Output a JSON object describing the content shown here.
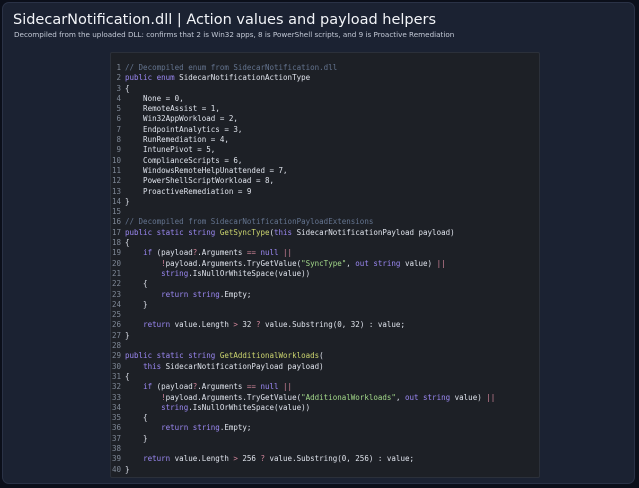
{
  "header": {
    "title": "SidecarNotification.dll  |  Action values and payload helpers",
    "subtitle": "Decompiled from the uploaded DLL: confirms that 2 is Win32 apps, 8 is PowerShell scripts, and 9 is Proactive Remediation"
  },
  "theme": {
    "background": "#0b0f1a",
    "card": "#1b2232",
    "code_background": "#1d2026",
    "comment": "#64748f",
    "keyword": "#9b88f3",
    "method": "#cdd66f",
    "string": "#a3d98a",
    "operator": "#d3869b",
    "plain": "#dfe3ec",
    "line_number": "#7f8896"
  },
  "code": {
    "language": "csharp",
    "lines": [
      {
        "n": "1",
        "tokens": [
          {
            "t": "// Decompiled enum from SidecarNotification.dll",
            "k": "comment"
          }
        ]
      },
      {
        "n": "2",
        "tokens": [
          {
            "t": "public",
            "k": "keyword"
          },
          {
            "t": " ",
            "k": "plain"
          },
          {
            "t": "enum",
            "k": "keyword"
          },
          {
            "t": " SidecarNotificationActionType",
            "k": "type"
          }
        ]
      },
      {
        "n": "3",
        "tokens": [
          {
            "t": "{",
            "k": "punct"
          }
        ]
      },
      {
        "n": "4",
        "tokens": [
          {
            "t": "    None = ",
            "k": "plain"
          },
          {
            "t": "0",
            "k": "number"
          },
          {
            "t": ",",
            "k": "punct"
          }
        ]
      },
      {
        "n": "5",
        "tokens": [
          {
            "t": "    RemoteAssist = ",
            "k": "plain"
          },
          {
            "t": "1",
            "k": "number"
          },
          {
            "t": ",",
            "k": "punct"
          }
        ]
      },
      {
        "n": "6",
        "tokens": [
          {
            "t": "    Win32AppWorkload = ",
            "k": "plain"
          },
          {
            "t": "2",
            "k": "number"
          },
          {
            "t": ",",
            "k": "punct"
          }
        ]
      },
      {
        "n": "7",
        "tokens": [
          {
            "t": "    EndpointAnalytics = ",
            "k": "plain"
          },
          {
            "t": "3",
            "k": "number"
          },
          {
            "t": ",",
            "k": "punct"
          }
        ]
      },
      {
        "n": "8",
        "tokens": [
          {
            "t": "    RunRemediation = ",
            "k": "plain"
          },
          {
            "t": "4",
            "k": "number"
          },
          {
            "t": ",",
            "k": "punct"
          }
        ]
      },
      {
        "n": "9",
        "tokens": [
          {
            "t": "    IntunePivot = ",
            "k": "plain"
          },
          {
            "t": "5",
            "k": "number"
          },
          {
            "t": ",",
            "k": "punct"
          }
        ]
      },
      {
        "n": "10",
        "tokens": [
          {
            "t": "    ComplianceScripts = ",
            "k": "plain"
          },
          {
            "t": "6",
            "k": "number"
          },
          {
            "t": ",",
            "k": "punct"
          }
        ]
      },
      {
        "n": "11",
        "tokens": [
          {
            "t": "    WindowsRemoteHelpUnattended = ",
            "k": "plain"
          },
          {
            "t": "7",
            "k": "number"
          },
          {
            "t": ",",
            "k": "punct"
          }
        ]
      },
      {
        "n": "12",
        "tokens": [
          {
            "t": "    PowerShellScriptWorkload = ",
            "k": "plain"
          },
          {
            "t": "8",
            "k": "number"
          },
          {
            "t": ",",
            "k": "punct"
          }
        ]
      },
      {
        "n": "13",
        "tokens": [
          {
            "t": "    ProactiveRemediation = ",
            "k": "plain"
          },
          {
            "t": "9",
            "k": "number"
          }
        ]
      },
      {
        "n": "14",
        "tokens": [
          {
            "t": "}",
            "k": "punct"
          }
        ]
      },
      {
        "n": "15",
        "tokens": []
      },
      {
        "n": "16",
        "tokens": [
          {
            "t": "// Decompiled from SidecarNotificationPayloadExtensions",
            "k": "comment"
          }
        ]
      },
      {
        "n": "17",
        "tokens": [
          {
            "t": "public",
            "k": "keyword"
          },
          {
            "t": " ",
            "k": "plain"
          },
          {
            "t": "static",
            "k": "keyword"
          },
          {
            "t": " ",
            "k": "plain"
          },
          {
            "t": "string",
            "k": "keyword"
          },
          {
            "t": " ",
            "k": "plain"
          },
          {
            "t": "GetSyncType",
            "k": "method"
          },
          {
            "t": "(",
            "k": "punct"
          },
          {
            "t": "this",
            "k": "keyword"
          },
          {
            "t": " SidecarNotificationPayload payload)",
            "k": "plain"
          }
        ]
      },
      {
        "n": "18",
        "tokens": [
          {
            "t": "{",
            "k": "punct"
          }
        ]
      },
      {
        "n": "19",
        "tokens": [
          {
            "t": "    ",
            "k": "plain"
          },
          {
            "t": "if",
            "k": "keyword"
          },
          {
            "t": " (payload",
            "k": "plain"
          },
          {
            "t": "?",
            "k": "op"
          },
          {
            "t": ".Arguments ",
            "k": "plain"
          },
          {
            "t": "==",
            "k": "op"
          },
          {
            "t": " ",
            "k": "plain"
          },
          {
            "t": "null",
            "k": "keyword"
          },
          {
            "t": " ",
            "k": "plain"
          },
          {
            "t": "||",
            "k": "op"
          }
        ]
      },
      {
        "n": "20",
        "tokens": [
          {
            "t": "        ",
            "k": "plain"
          },
          {
            "t": "!",
            "k": "op"
          },
          {
            "t": "payload.Arguments.TryGetValue(",
            "k": "plain"
          },
          {
            "t": "\"SyncType\"",
            "k": "string"
          },
          {
            "t": ", ",
            "k": "plain"
          },
          {
            "t": "out",
            "k": "keyword"
          },
          {
            "t": " ",
            "k": "plain"
          },
          {
            "t": "string",
            "k": "keyword"
          },
          {
            "t": " value) ",
            "k": "plain"
          },
          {
            "t": "||",
            "k": "op"
          }
        ]
      },
      {
        "n": "21",
        "tokens": [
          {
            "t": "        ",
            "k": "plain"
          },
          {
            "t": "string",
            "k": "keyword"
          },
          {
            "t": ".IsNullOrWhiteSpace(value))",
            "k": "plain"
          }
        ]
      },
      {
        "n": "22",
        "tokens": [
          {
            "t": "    {",
            "k": "punct"
          }
        ]
      },
      {
        "n": "23",
        "tokens": [
          {
            "t": "        ",
            "k": "plain"
          },
          {
            "t": "return",
            "k": "keyword"
          },
          {
            "t": " ",
            "k": "plain"
          },
          {
            "t": "string",
            "k": "keyword"
          },
          {
            "t": ".Empty;",
            "k": "plain"
          }
        ]
      },
      {
        "n": "24",
        "tokens": [
          {
            "t": "    }",
            "k": "punct"
          }
        ]
      },
      {
        "n": "25",
        "tokens": []
      },
      {
        "n": "26",
        "tokens": [
          {
            "t": "    ",
            "k": "plain"
          },
          {
            "t": "return",
            "k": "keyword"
          },
          {
            "t": " value.Length ",
            "k": "plain"
          },
          {
            "t": ">",
            "k": "op"
          },
          {
            "t": " ",
            "k": "plain"
          },
          {
            "t": "32",
            "k": "number"
          },
          {
            "t": " ",
            "k": "plain"
          },
          {
            "t": "?",
            "k": "op"
          },
          {
            "t": " value.Substring(",
            "k": "plain"
          },
          {
            "t": "0",
            "k": "number"
          },
          {
            "t": ", ",
            "k": "plain"
          },
          {
            "t": "32",
            "k": "number"
          },
          {
            "t": ") : value;",
            "k": "plain"
          }
        ]
      },
      {
        "n": "27",
        "tokens": [
          {
            "t": "}",
            "k": "punct"
          }
        ]
      },
      {
        "n": "28",
        "tokens": []
      },
      {
        "n": "29",
        "tokens": [
          {
            "t": "public",
            "k": "keyword"
          },
          {
            "t": " ",
            "k": "plain"
          },
          {
            "t": "static",
            "k": "keyword"
          },
          {
            "t": " ",
            "k": "plain"
          },
          {
            "t": "string",
            "k": "keyword"
          },
          {
            "t": " ",
            "k": "plain"
          },
          {
            "t": "GetAdditionalWorkloads",
            "k": "method"
          },
          {
            "t": "(",
            "k": "punct"
          }
        ]
      },
      {
        "n": "30",
        "tokens": [
          {
            "t": "    ",
            "k": "plain"
          },
          {
            "t": "this",
            "k": "keyword"
          },
          {
            "t": " SidecarNotificationPayload payload)",
            "k": "plain"
          }
        ]
      },
      {
        "n": "31",
        "tokens": [
          {
            "t": "{",
            "k": "punct"
          }
        ]
      },
      {
        "n": "32",
        "tokens": [
          {
            "t": "    ",
            "k": "plain"
          },
          {
            "t": "if",
            "k": "keyword"
          },
          {
            "t": " (payload",
            "k": "plain"
          },
          {
            "t": "?",
            "k": "op"
          },
          {
            "t": ".Arguments ",
            "k": "plain"
          },
          {
            "t": "==",
            "k": "op"
          },
          {
            "t": " ",
            "k": "plain"
          },
          {
            "t": "null",
            "k": "keyword"
          },
          {
            "t": " ",
            "k": "plain"
          },
          {
            "t": "||",
            "k": "op"
          }
        ]
      },
      {
        "n": "33",
        "tokens": [
          {
            "t": "        ",
            "k": "plain"
          },
          {
            "t": "!",
            "k": "op"
          },
          {
            "t": "payload.Arguments.TryGetValue(",
            "k": "plain"
          },
          {
            "t": "\"AdditionalWorkloads\"",
            "k": "string"
          },
          {
            "t": ", ",
            "k": "plain"
          },
          {
            "t": "out",
            "k": "keyword"
          },
          {
            "t": " ",
            "k": "plain"
          },
          {
            "t": "string",
            "k": "keyword"
          },
          {
            "t": " value) ",
            "k": "plain"
          },
          {
            "t": "||",
            "k": "op"
          }
        ]
      },
      {
        "n": "34",
        "tokens": [
          {
            "t": "        ",
            "k": "plain"
          },
          {
            "t": "string",
            "k": "keyword"
          },
          {
            "t": ".IsNullOrWhiteSpace(value))",
            "k": "plain"
          }
        ]
      },
      {
        "n": "35",
        "tokens": [
          {
            "t": "    {",
            "k": "punct"
          }
        ]
      },
      {
        "n": "36",
        "tokens": [
          {
            "t": "        ",
            "k": "plain"
          },
          {
            "t": "return",
            "k": "keyword"
          },
          {
            "t": " ",
            "k": "plain"
          },
          {
            "t": "string",
            "k": "keyword"
          },
          {
            "t": ".Empty;",
            "k": "plain"
          }
        ]
      },
      {
        "n": "37",
        "tokens": [
          {
            "t": "    }",
            "k": "punct"
          }
        ]
      },
      {
        "n": "38",
        "tokens": []
      },
      {
        "n": "39",
        "tokens": [
          {
            "t": "    ",
            "k": "plain"
          },
          {
            "t": "return",
            "k": "keyword"
          },
          {
            "t": " value.Length ",
            "k": "plain"
          },
          {
            "t": ">",
            "k": "op"
          },
          {
            "t": " ",
            "k": "plain"
          },
          {
            "t": "256",
            "k": "number"
          },
          {
            "t": " ",
            "k": "plain"
          },
          {
            "t": "?",
            "k": "op"
          },
          {
            "t": " value.Substring(",
            "k": "plain"
          },
          {
            "t": "0",
            "k": "number"
          },
          {
            "t": ", ",
            "k": "plain"
          },
          {
            "t": "256",
            "k": "number"
          },
          {
            "t": ") : value;",
            "k": "plain"
          }
        ]
      },
      {
        "n": "40",
        "tokens": [
          {
            "t": "}",
            "k": "punct"
          }
        ]
      }
    ]
  }
}
